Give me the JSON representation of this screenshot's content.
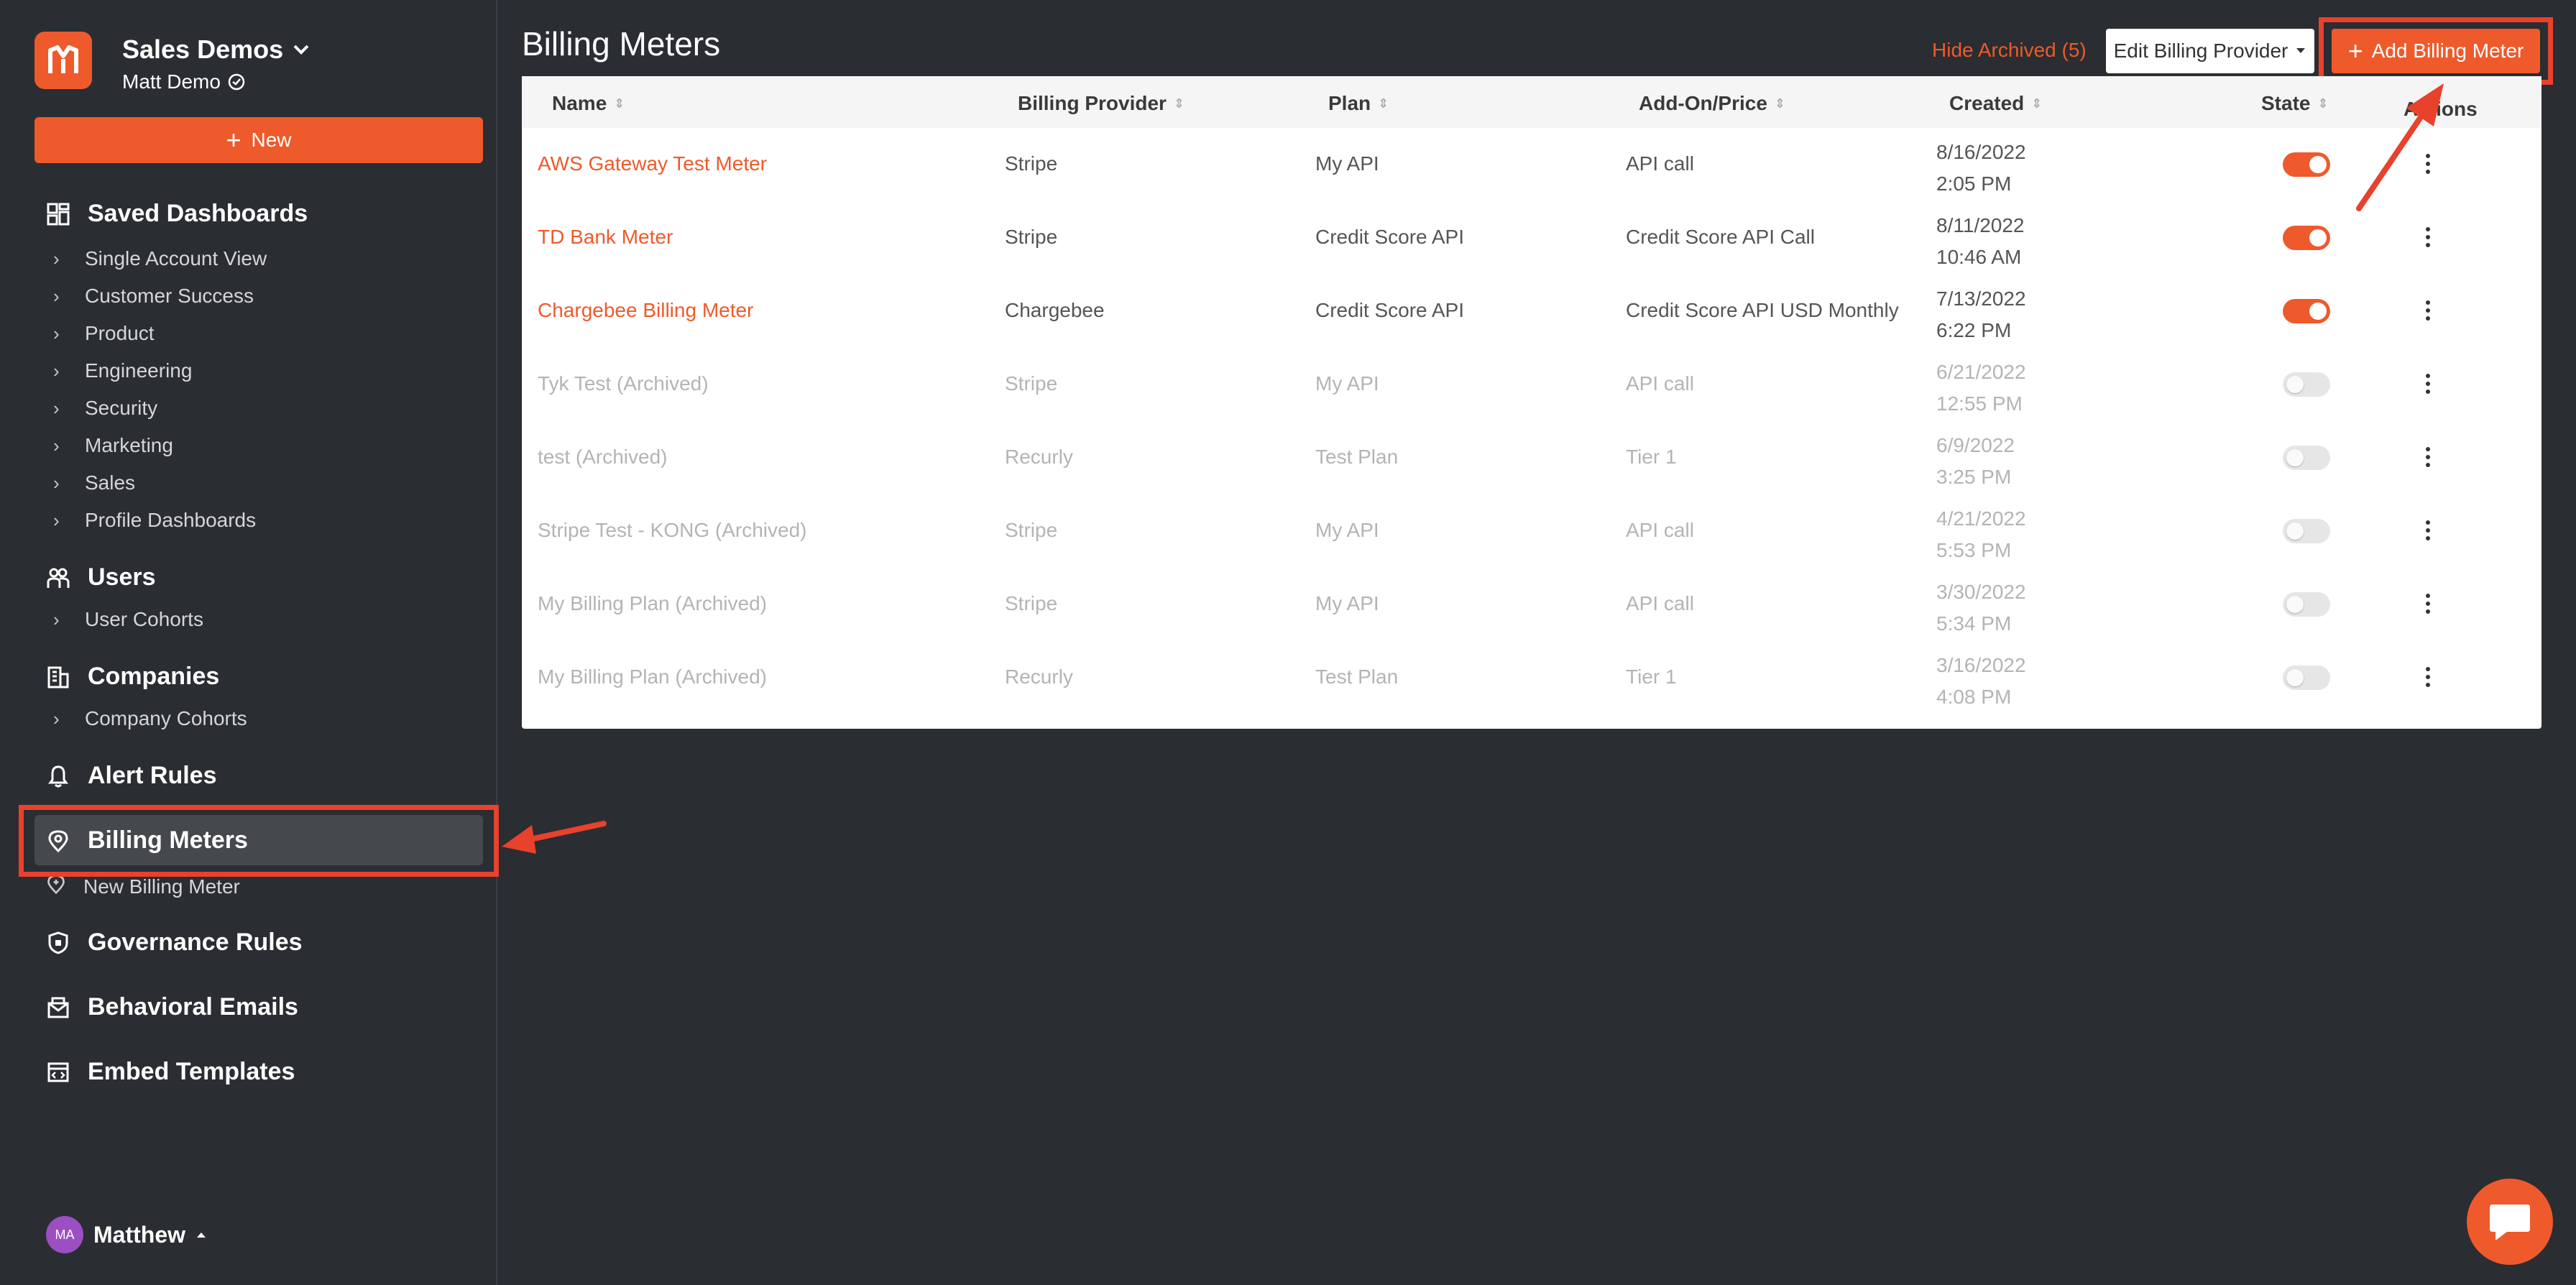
{
  "brand": {
    "org_name": "Sales Demos",
    "user_label": "Matt Demo",
    "accent_color": "#ee5a2b"
  },
  "sidebar": {
    "new_label": "New",
    "sections": [
      {
        "title": "Saved Dashboards",
        "icon": "dashboard-icon",
        "items": [
          "Single Account View",
          "Customer Success",
          "Product",
          "Engineering",
          "Security",
          "Marketing",
          "Sales",
          "Profile Dashboards"
        ]
      },
      {
        "title": "Users",
        "icon": "users-icon",
        "items": [
          "User Cohorts"
        ]
      },
      {
        "title": "Companies",
        "icon": "building-icon",
        "items": [
          "Company Cohorts"
        ]
      },
      {
        "title": "Alert Rules",
        "icon": "bell-icon",
        "items": []
      },
      {
        "title": "Billing Meters",
        "icon": "meter-icon",
        "items": [
          "New Billing Meter"
        ]
      },
      {
        "title": "Governance Rules",
        "icon": "shield-icon",
        "items": []
      },
      {
        "title": "Behavioral Emails",
        "icon": "mail-icon",
        "items": []
      },
      {
        "title": "Embed Templates",
        "icon": "embed-icon",
        "items": []
      }
    ],
    "footer_user": {
      "initials": "MA",
      "name": "Matthew"
    }
  },
  "main": {
    "title": "Billing Meters",
    "hide_archived": "Hide Archived (5)",
    "edit_provider": "Edit Billing Provider",
    "add_button": "Add Billing Meter",
    "columns": [
      "Name",
      "Billing Provider",
      "Plan",
      "Add-On/Price",
      "Created",
      "State",
      "Actions"
    ],
    "rows": [
      {
        "name": "AWS Gateway Test Meter",
        "provider": "Stripe",
        "plan": "My API",
        "addon": "API call",
        "date": "8/16/2022",
        "time": "2:05 PM",
        "state": "on",
        "archived": false
      },
      {
        "name": "TD Bank Meter",
        "provider": "Stripe",
        "plan": "Credit Score API",
        "addon": "Credit Score API Call",
        "date": "8/11/2022",
        "time": "10:46 AM",
        "state": "on",
        "archived": false
      },
      {
        "name": "Chargebee Billing Meter",
        "provider": "Chargebee",
        "plan": "Credit Score API",
        "addon": "Credit Score API USD Monthly",
        "date": "7/13/2022",
        "time": "6:22 PM",
        "state": "on",
        "archived": false
      },
      {
        "name": "Tyk Test (Archived)",
        "provider": "Stripe",
        "plan": "My API",
        "addon": "API call",
        "date": "6/21/2022",
        "time": "12:55 PM",
        "state": "off",
        "archived": true
      },
      {
        "name": "test (Archived)",
        "provider": "Recurly",
        "plan": "Test Plan",
        "addon": "Tier 1",
        "date": "6/9/2022",
        "time": "3:25 PM",
        "state": "off",
        "archived": true
      },
      {
        "name": "Stripe Test - KONG (Archived)",
        "provider": "Stripe",
        "plan": "My API",
        "addon": "API call",
        "date": "4/21/2022",
        "time": "5:53 PM",
        "state": "off",
        "archived": true
      },
      {
        "name": "My Billing Plan (Archived)",
        "provider": "Stripe",
        "plan": "My API",
        "addon": "API call",
        "date": "3/30/2022",
        "time": "5:34 PM",
        "state": "off",
        "archived": true
      },
      {
        "name": "My Billing Plan (Archived)",
        "provider": "Recurly",
        "plan": "Test Plan",
        "addon": "Tier 1",
        "date": "3/16/2022",
        "time": "4:08 PM",
        "state": "off",
        "archived": true
      }
    ]
  }
}
